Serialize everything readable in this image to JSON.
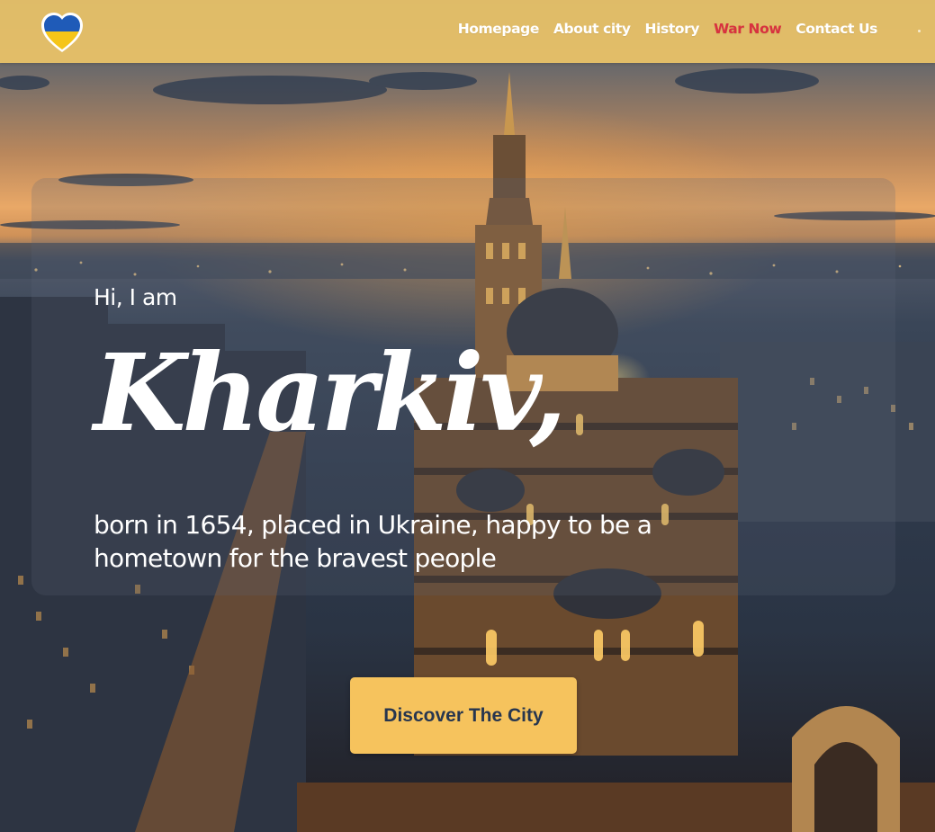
{
  "header": {
    "logo_icon": "ukraine-heart-icon",
    "nav": [
      {
        "label": "Homepage",
        "active": false
      },
      {
        "label": "About city",
        "active": false
      },
      {
        "label": "History",
        "active": false
      },
      {
        "label": "War Now",
        "active": true
      },
      {
        "label": "Contact Us",
        "active": false
      }
    ]
  },
  "hero": {
    "greeting": "Hi, I am",
    "city_name": "Kharkiv,",
    "tagline": "born in 1654, placed in Ukraine, happy to be a hometown for the bravest people",
    "cta_label": "Discover The City"
  },
  "colors": {
    "header_bg": "#ecc468",
    "active_nav": "#d8323f",
    "cta_bg": "#f6c35d",
    "cta_text": "#27364f",
    "flag_blue": "#1f5bb8",
    "flag_yellow": "#f5c518"
  }
}
